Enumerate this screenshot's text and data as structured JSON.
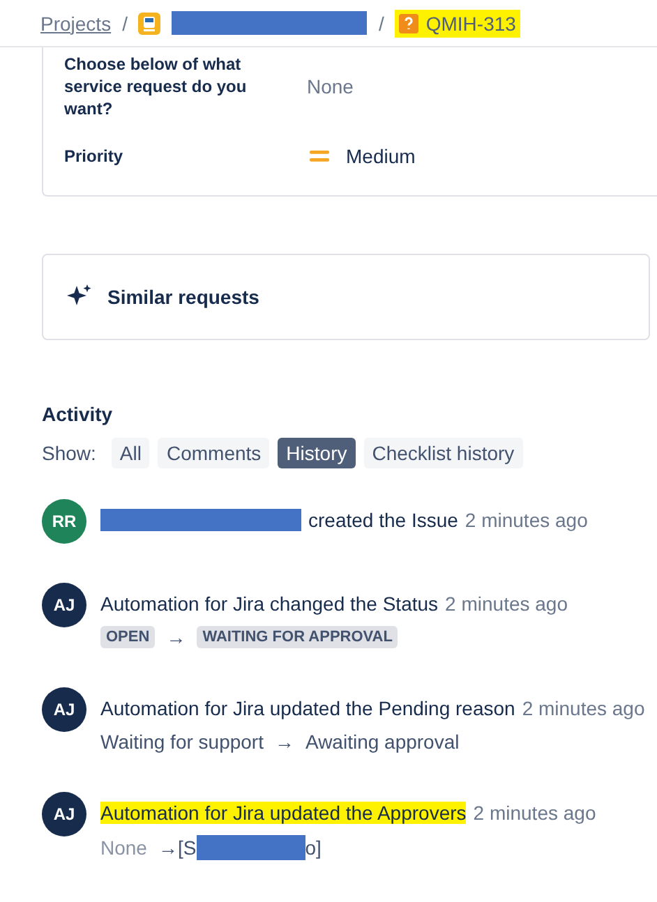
{
  "breadcrumb": {
    "projects_link": "Projects",
    "separators": [
      "/",
      "/"
    ],
    "issue_key": "QMIH-313",
    "issue_highlighted": true,
    "project_redacted": true
  },
  "fields": [
    {
      "label": "Choose below of what service request do you want?",
      "value": "None",
      "kind": "plain"
    },
    {
      "label": "Priority",
      "value": "Medium",
      "kind": "priority"
    }
  ],
  "similar_requests": "Similar requests",
  "activity": {
    "title": "Activity",
    "show_label": "Show:",
    "filters": [
      {
        "label": "All",
        "selected": false
      },
      {
        "label": "Comments",
        "selected": false
      },
      {
        "label": "History",
        "selected": true
      },
      {
        "label": "Checklist history",
        "selected": false
      }
    ],
    "entries": [
      {
        "initials": "RR",
        "color": "#1f845a",
        "actor_redacted": true,
        "text": "created the Issue",
        "time": "2 minutes ago",
        "highlighted": false
      },
      {
        "initials": "AJ",
        "color": "#172b4d",
        "actor_redacted": false,
        "text": "Automation for Jira changed the Status",
        "time": "2 minutes ago",
        "highlighted": false,
        "change": {
          "kind": "lozenge",
          "from": "OPEN",
          "arrow": "→",
          "to": "WAITING FOR APPROVAL"
        }
      },
      {
        "initials": "AJ",
        "color": "#172b4d",
        "actor_redacted": false,
        "text": "Automation for Jira updated the Pending reason",
        "time": "2 minutes ago",
        "highlighted": false,
        "change": {
          "kind": "text",
          "from": "Waiting for support",
          "arrow": "→",
          "to": "Awaiting approval"
        }
      },
      {
        "initials": "AJ",
        "color": "#172b4d",
        "actor_redacted": false,
        "text": "Automation for Jira updated the Approvers",
        "time": "2 minutes ago",
        "highlighted": true,
        "change": {
          "kind": "redacted",
          "from": "None",
          "arrow": "→",
          "to_start": "[S",
          "to_end": "o]"
        }
      }
    ]
  }
}
